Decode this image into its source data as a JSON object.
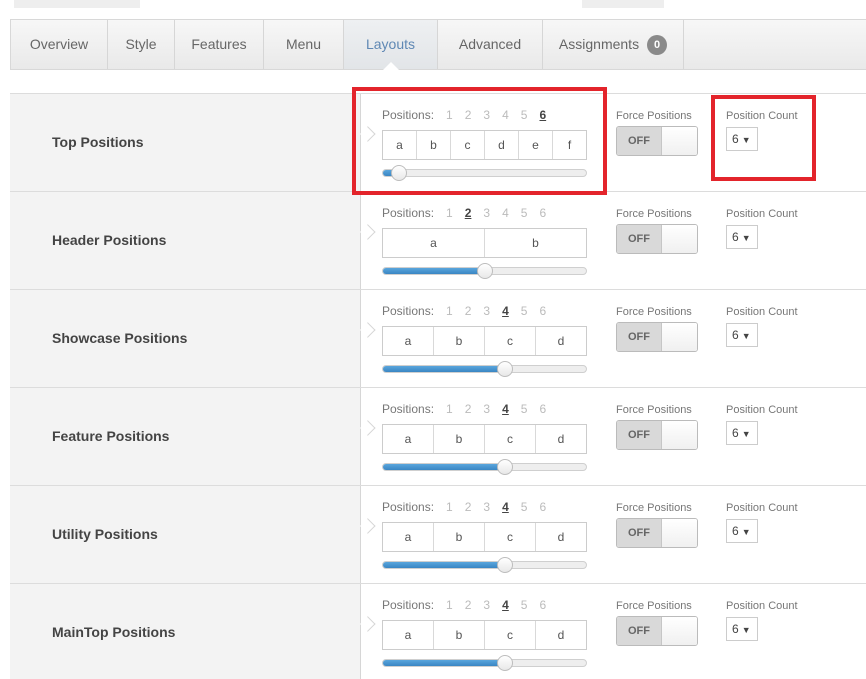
{
  "tabs": [
    {
      "label": "Overview",
      "active": false
    },
    {
      "label": "Style",
      "active": false
    },
    {
      "label": "Features",
      "active": false
    },
    {
      "label": "Menu",
      "active": false
    },
    {
      "label": "Layouts",
      "active": true
    },
    {
      "label": "Advanced",
      "active": false
    },
    {
      "label": "Assignments",
      "active": false,
      "badge": "0"
    }
  ],
  "positions_label": "Positions:",
  "position_numbers": [
    "1",
    "2",
    "3",
    "4",
    "5",
    "6"
  ],
  "force_label": "Force Positions",
  "toggle_off": "OFF",
  "count_label": "Position Count",
  "rows": [
    {
      "title": "Top Positions",
      "selected": 6,
      "cells": [
        "a",
        "b",
        "c",
        "d",
        "e",
        "f"
      ],
      "slider_fraction": 0.08,
      "count": "6"
    },
    {
      "title": "Header Positions",
      "selected": 2,
      "cells": [
        "a",
        "b"
      ],
      "slider_fraction": 0.5,
      "count": "6"
    },
    {
      "title": "Showcase Positions",
      "selected": 4,
      "cells": [
        "a",
        "b",
        "c",
        "d"
      ],
      "slider_fraction": 0.6,
      "count": "6"
    },
    {
      "title": "Feature Positions",
      "selected": 4,
      "cells": [
        "a",
        "b",
        "c",
        "d"
      ],
      "slider_fraction": 0.6,
      "count": "6"
    },
    {
      "title": "Utility Positions",
      "selected": 4,
      "cells": [
        "a",
        "b",
        "c",
        "d"
      ],
      "slider_fraction": 0.6,
      "count": "6"
    },
    {
      "title": "MainTop Positions",
      "selected": 4,
      "cells": [
        "a",
        "b",
        "c",
        "d"
      ],
      "slider_fraction": 0.6,
      "count": "6"
    }
  ],
  "colors": {
    "highlight": "#e3242b",
    "active_tab_text": "#5f88b4",
    "slider_fill": "#3a86c3"
  }
}
